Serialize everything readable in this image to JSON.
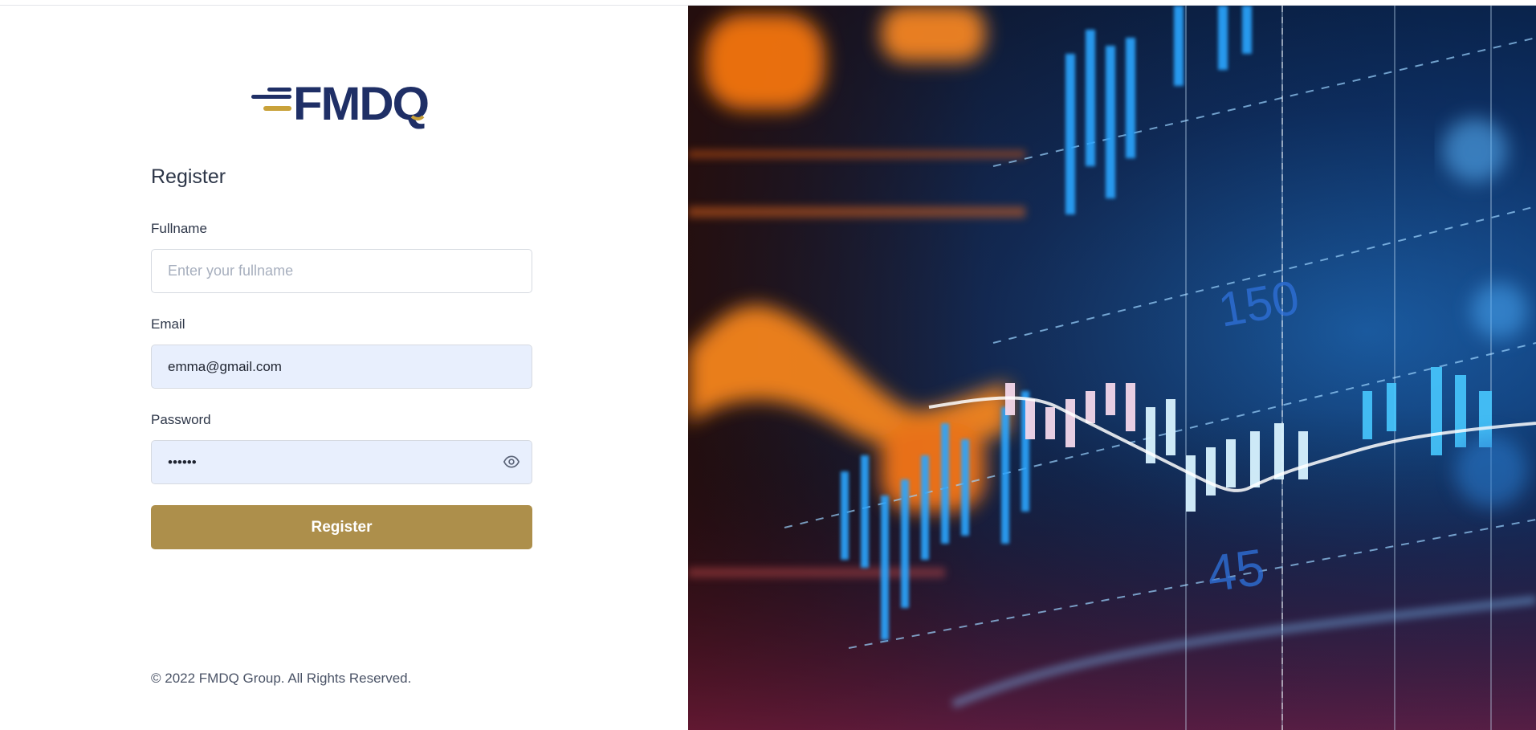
{
  "brand": {
    "logo_text": "FMDQ"
  },
  "form": {
    "title": "Register",
    "fullname": {
      "label": "Fullname",
      "placeholder": "Enter your fullname",
      "value": ""
    },
    "email": {
      "label": "Email",
      "value": "emma@gmail.com"
    },
    "password": {
      "label": "Password",
      "value": "••••••"
    },
    "submit_label": "Register"
  },
  "footer": {
    "copyright": "© 2022 FMDQ Group. All Rights Reserved."
  },
  "hero": {
    "description": "financial trading chart background image",
    "chart_numbers": [
      "150",
      "45"
    ]
  },
  "colors": {
    "brand_navy": "#1f2f66",
    "brand_gold": "#c9a23a",
    "button": "#ad8f4b",
    "input_filled_bg": "#e8effd"
  }
}
